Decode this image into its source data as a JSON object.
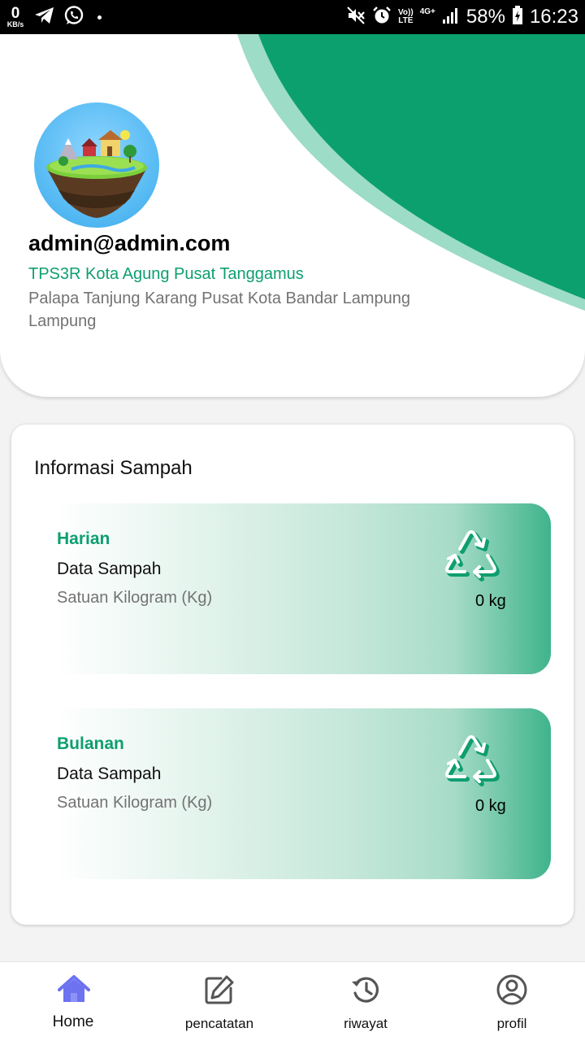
{
  "status_bar": {
    "net_speed_value": "0",
    "net_speed_unit": "KB/s",
    "volte_top": "Vo))",
    "volte_bottom": "LTE",
    "network": "4G+",
    "battery": "58%",
    "time": "16:23"
  },
  "profile": {
    "email": "admin@admin.com",
    "organization": "TPS3R Kota Agung Pusat  Tanggamus",
    "address": "Palapa Tanjung Karang Pusat Kota Bandar Lampung Lampung"
  },
  "info": {
    "title": "Informasi Sampah",
    "cards": [
      {
        "period": "Harian",
        "label": "Data Sampah",
        "unit": "Satuan Kilogram (Kg)",
        "value": "0 kg",
        "icon": "recycle-icon"
      },
      {
        "period": "Bulanan",
        "label": "Data Sampah",
        "unit": "Satuan Kilogram (Kg)",
        "value": "0 kg",
        "icon": "recycle-icon"
      }
    ]
  },
  "nav": {
    "items": [
      {
        "label": "Home",
        "icon": "home-icon",
        "active": true
      },
      {
        "label": "pencatatan",
        "icon": "edit-icon",
        "active": false
      },
      {
        "label": "riwayat",
        "icon": "history-icon",
        "active": false
      },
      {
        "label": "profil",
        "icon": "user-circle-icon",
        "active": false
      }
    ]
  },
  "colors": {
    "accent_green": "#0e9e70",
    "wave_green": "#0ca06e",
    "wave_light": "#9ddcc6",
    "nav_active": "#6c72f0"
  }
}
